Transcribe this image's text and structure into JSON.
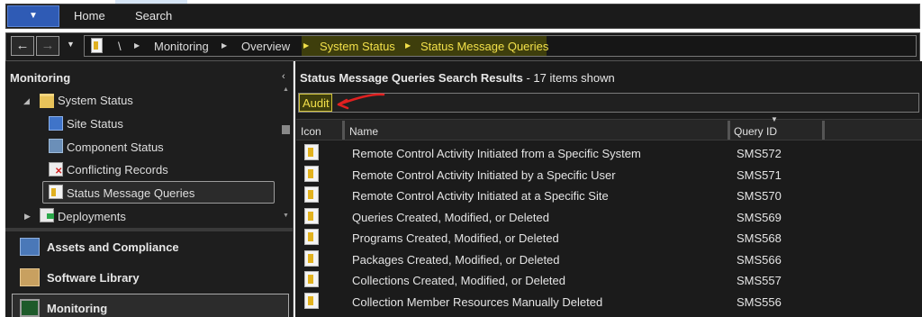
{
  "ribbon": {
    "app_button": "▼",
    "tabs": [
      "Home",
      "Search"
    ]
  },
  "address": {
    "root_sep": "\\",
    "crumbs": [
      "Monitoring",
      "Overview",
      "System Status",
      "Status Message Queries"
    ]
  },
  "nav": {
    "title": "Monitoring",
    "collapse": "‹",
    "tree": {
      "system_status": "System Status",
      "site_status": "Site Status",
      "component_status": "Component Status",
      "conflicting_records": "Conflicting Records",
      "status_message_queries": "Status Message Queries",
      "deployments": "Deployments"
    },
    "workspaces": [
      "Assets and Compliance",
      "Software Library",
      "Monitoring"
    ]
  },
  "results": {
    "title": "Status Message Queries Search Results",
    "count": " -  17 items shown",
    "search_value": "Audit",
    "columns": [
      "Icon",
      "Name",
      "Query ID"
    ],
    "rows": [
      {
        "name": "Remote Control Activity Initiated from a Specific System",
        "id": "SMS572"
      },
      {
        "name": "Remote Control Activity Initiated by a Specific User",
        "id": "SMS571"
      },
      {
        "name": "Remote Control Activity Initiated at a Specific Site",
        "id": "SMS570"
      },
      {
        "name": "Queries Created, Modified, or Deleted",
        "id": "SMS569"
      },
      {
        "name": "Programs Created, Modified, or Deleted",
        "id": "SMS568"
      },
      {
        "name": "Packages Created, Modified, or Deleted",
        "id": "SMS566"
      },
      {
        "name": "Collections Created, Modified, or Deleted",
        "id": "SMS557"
      },
      {
        "name": "Collection Member Resources Manually Deleted",
        "id": "SMS556"
      }
    ]
  },
  "colors": {
    "highlight_text": "#f2e04a",
    "highlight_bg": "#3e3e0c",
    "annotation_red": "#e02020",
    "app_button": "#2f5bb5"
  }
}
